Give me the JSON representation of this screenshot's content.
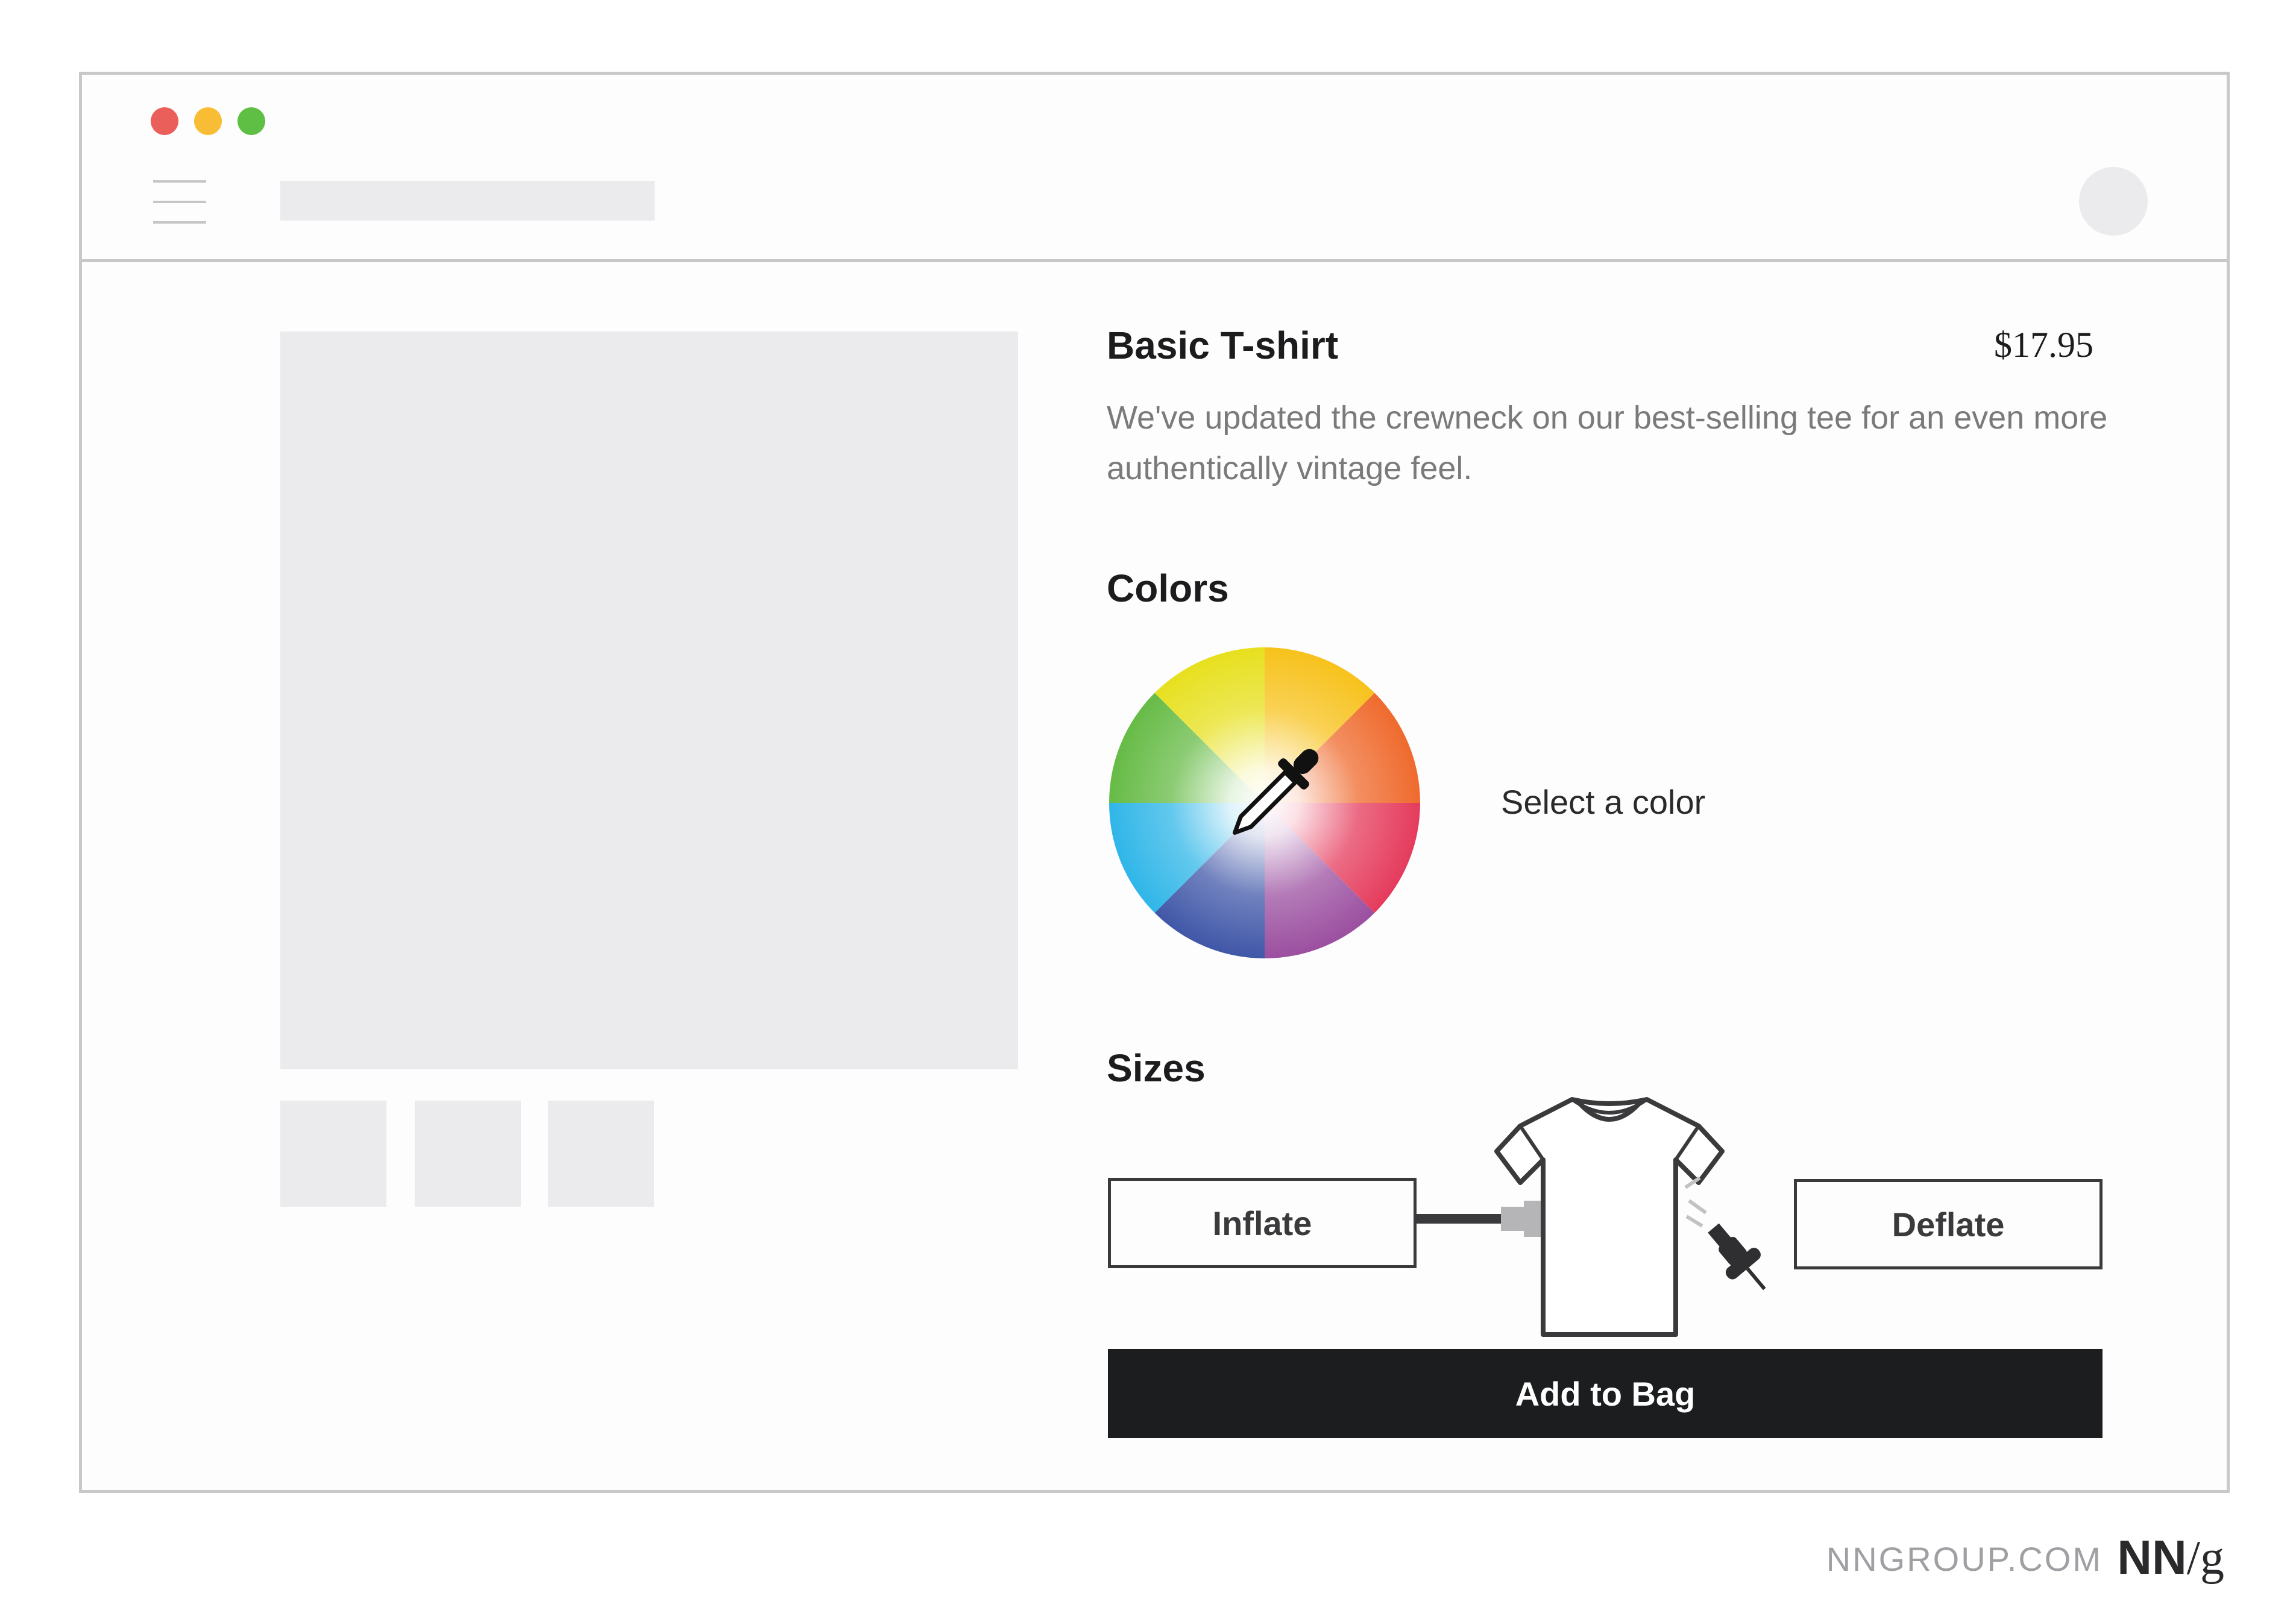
{
  "window": {
    "controls": [
      {
        "name": "close",
        "color": "#eb5f5b"
      },
      {
        "name": "minimize",
        "color": "#f8bd35"
      },
      {
        "name": "maximize",
        "color": "#5fbf45"
      }
    ]
  },
  "product": {
    "title": "Basic T-shirt",
    "price": "$17.95",
    "description": "We've updated the crewneck on our best-selling tee for an even more authentically vintage feel."
  },
  "colors": {
    "heading": "Colors",
    "select_label": "Select a color"
  },
  "sizes": {
    "heading": "Sizes",
    "inflate_label": "Inflate",
    "deflate_label": "Deflate"
  },
  "actions": {
    "add_to_bag_label": "Add to Bag"
  },
  "footer": {
    "site": "NNGROUP.COM",
    "logo_nn": "NN",
    "logo_slash": "/",
    "logo_g": "g"
  },
  "icons": [
    "hamburger-menu-icon",
    "avatar-icon",
    "eyedropper-icon",
    "tshirt-icon",
    "air-pump-icon",
    "pushpin-icon"
  ]
}
